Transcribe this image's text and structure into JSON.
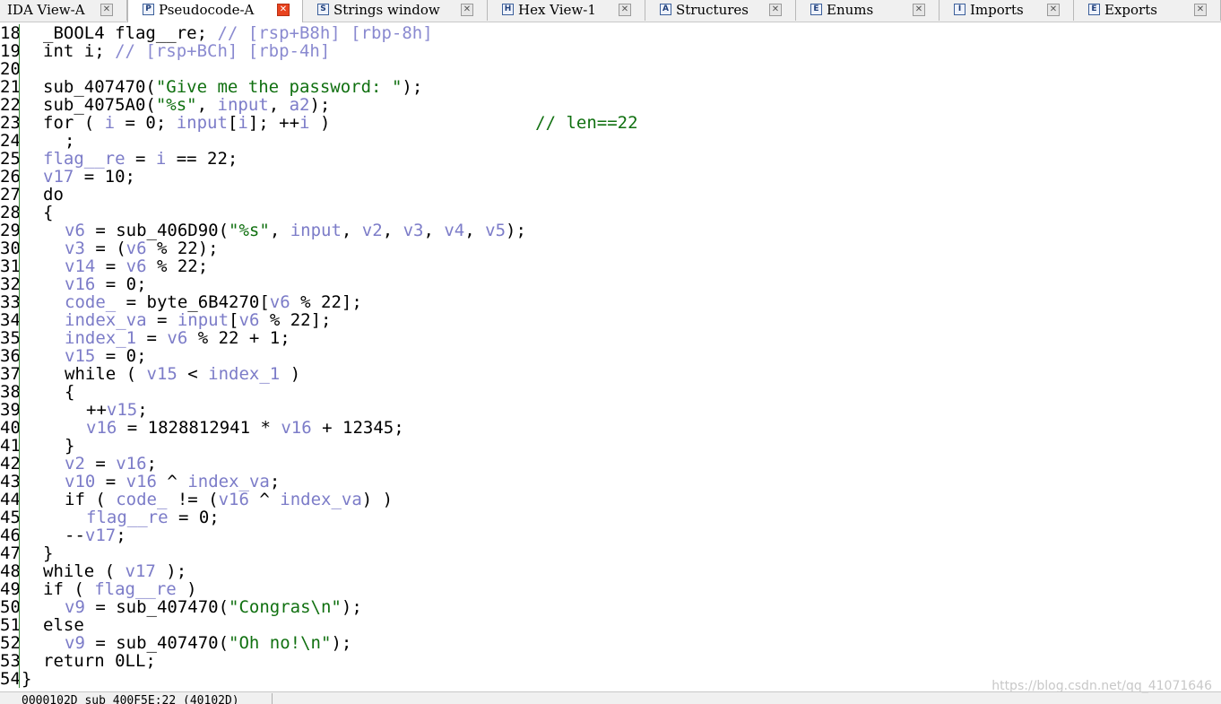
{
  "tabs": [
    {
      "label": "IDA View-A",
      "icon": "ida-view-icon",
      "active": false
    },
    {
      "label": "Pseudocode-A",
      "icon": "pseudocode-icon",
      "active": true
    },
    {
      "label": "Strings window",
      "icon": "strings-icon",
      "active": false
    },
    {
      "label": "Hex View-1",
      "icon": "hex-view-icon",
      "active": false
    },
    {
      "label": "Structures",
      "icon": "structures-icon",
      "active": false
    },
    {
      "label": "Enums",
      "icon": "enums-icon",
      "active": false
    },
    {
      "label": "Imports",
      "icon": "imports-icon",
      "active": false
    },
    {
      "label": "Exports",
      "icon": "exports-icon",
      "active": false
    }
  ],
  "code_lines": [
    {
      "num": "18",
      "indent": 1,
      "segments": [
        {
          "t": "_BOOL4 flag__re; ",
          "c": "k"
        },
        {
          "t": "// [rsp+B8h] [rbp-8h]",
          "c": "trans"
        }
      ]
    },
    {
      "num": "19",
      "indent": 1,
      "segments": [
        {
          "t": "int i; ",
          "c": "k"
        },
        {
          "t": "// [rsp+BCh] [rbp-4h]",
          "c": "trans"
        }
      ]
    },
    {
      "num": "20",
      "indent": 0,
      "segments": []
    },
    {
      "num": "21",
      "indent": 1,
      "segments": [
        {
          "t": "sub_407470(",
          "c": "k"
        },
        {
          "t": "\"Give me the password: \"",
          "c": "str"
        },
        {
          "t": ");",
          "c": "k"
        }
      ]
    },
    {
      "num": "22",
      "indent": 1,
      "segments": [
        {
          "t": "sub_4075A0(",
          "c": "k"
        },
        {
          "t": "\"%s\"",
          "c": "str"
        },
        {
          "t": ", ",
          "c": "k"
        },
        {
          "t": "input",
          "c": "var"
        },
        {
          "t": ", ",
          "c": "k"
        },
        {
          "t": "a2",
          "c": "var"
        },
        {
          "t": ");",
          "c": "k"
        }
      ]
    },
    {
      "num": "23",
      "indent": 1,
      "segments": [
        {
          "t": "for ( ",
          "c": "k"
        },
        {
          "t": "i",
          "c": "var"
        },
        {
          "t": " = 0; ",
          "c": "k"
        },
        {
          "t": "input",
          "c": "var"
        },
        {
          "t": "[",
          "c": "k"
        },
        {
          "t": "i",
          "c": "var"
        },
        {
          "t": "]; ++",
          "c": "k"
        },
        {
          "t": "i",
          "c": "var"
        },
        {
          "t": " )                    ",
          "c": "k"
        },
        {
          "t": "// len==22",
          "c": "cmt"
        }
      ]
    },
    {
      "num": "24",
      "indent": 2,
      "segments": [
        {
          "t": ";",
          "c": "k"
        }
      ]
    },
    {
      "num": "25",
      "indent": 1,
      "segments": [
        {
          "t": "flag__re",
          "c": "var"
        },
        {
          "t": " = ",
          "c": "k"
        },
        {
          "t": "i",
          "c": "var"
        },
        {
          "t": " == 22;",
          "c": "k"
        }
      ]
    },
    {
      "num": "26",
      "indent": 1,
      "segments": [
        {
          "t": "v17",
          "c": "var"
        },
        {
          "t": " = 10;",
          "c": "k"
        }
      ]
    },
    {
      "num": "27",
      "indent": 1,
      "segments": [
        {
          "t": "do",
          "c": "k"
        }
      ]
    },
    {
      "num": "28",
      "indent": 1,
      "segments": [
        {
          "t": "{",
          "c": "k"
        }
      ]
    },
    {
      "num": "29",
      "indent": 2,
      "segments": [
        {
          "t": "v6",
          "c": "var"
        },
        {
          "t": " = sub_406D90(",
          "c": "k"
        },
        {
          "t": "\"%s\"",
          "c": "str"
        },
        {
          "t": ", ",
          "c": "k"
        },
        {
          "t": "input",
          "c": "var"
        },
        {
          "t": ", ",
          "c": "k"
        },
        {
          "t": "v2",
          "c": "var"
        },
        {
          "t": ", ",
          "c": "k"
        },
        {
          "t": "v3",
          "c": "var"
        },
        {
          "t": ", ",
          "c": "k"
        },
        {
          "t": "v4",
          "c": "var"
        },
        {
          "t": ", ",
          "c": "k"
        },
        {
          "t": "v5",
          "c": "var"
        },
        {
          "t": ");",
          "c": "k"
        }
      ]
    },
    {
      "num": "30",
      "indent": 2,
      "segments": [
        {
          "t": "v3",
          "c": "var"
        },
        {
          "t": " = (",
          "c": "k"
        },
        {
          "t": "v6",
          "c": "var"
        },
        {
          "t": " % 22);",
          "c": "k"
        }
      ]
    },
    {
      "num": "31",
      "indent": 2,
      "segments": [
        {
          "t": "v14",
          "c": "var"
        },
        {
          "t": " = ",
          "c": "k"
        },
        {
          "t": "v6",
          "c": "var"
        },
        {
          "t": " % 22;",
          "c": "k"
        }
      ]
    },
    {
      "num": "32",
      "indent": 2,
      "segments": [
        {
          "t": "v16",
          "c": "var"
        },
        {
          "t": " = 0;",
          "c": "k"
        }
      ]
    },
    {
      "num": "33",
      "indent": 2,
      "segments": [
        {
          "t": "code_",
          "c": "var"
        },
        {
          "t": " = byte_6B4270[",
          "c": "k"
        },
        {
          "t": "v6",
          "c": "var"
        },
        {
          "t": " % 22];",
          "c": "k"
        }
      ]
    },
    {
      "num": "34",
      "indent": 2,
      "segments": [
        {
          "t": "index_va",
          "c": "var"
        },
        {
          "t": " = ",
          "c": "k"
        },
        {
          "t": "input",
          "c": "var"
        },
        {
          "t": "[",
          "c": "k"
        },
        {
          "t": "v6",
          "c": "var"
        },
        {
          "t": " % 22];",
          "c": "k"
        }
      ]
    },
    {
      "num": "35",
      "indent": 2,
      "segments": [
        {
          "t": "index_1",
          "c": "var"
        },
        {
          "t": " = ",
          "c": "k"
        },
        {
          "t": "v6",
          "c": "var"
        },
        {
          "t": " % 22 + 1;",
          "c": "k"
        }
      ]
    },
    {
      "num": "36",
      "indent": 2,
      "segments": [
        {
          "t": "v15",
          "c": "var"
        },
        {
          "t": " = 0;",
          "c": "k"
        }
      ]
    },
    {
      "num": "37",
      "indent": 2,
      "segments": [
        {
          "t": "while ( ",
          "c": "k"
        },
        {
          "t": "v15",
          "c": "var"
        },
        {
          "t": " < ",
          "c": "k"
        },
        {
          "t": "index_1",
          "c": "var"
        },
        {
          "t": " )",
          "c": "k"
        }
      ]
    },
    {
      "num": "38",
      "indent": 2,
      "segments": [
        {
          "t": "{",
          "c": "k"
        }
      ]
    },
    {
      "num": "39",
      "indent": 3,
      "segments": [
        {
          "t": "++",
          "c": "k"
        },
        {
          "t": "v15",
          "c": "var"
        },
        {
          "t": ";",
          "c": "k"
        }
      ]
    },
    {
      "num": "40",
      "indent": 3,
      "segments": [
        {
          "t": "v16",
          "c": "var"
        },
        {
          "t": " = 1828812941 * ",
          "c": "k"
        },
        {
          "t": "v16",
          "c": "var"
        },
        {
          "t": " + 12345;",
          "c": "k"
        }
      ]
    },
    {
      "num": "41",
      "indent": 2,
      "segments": [
        {
          "t": "}",
          "c": "k"
        }
      ]
    },
    {
      "num": "42",
      "indent": 2,
      "segments": [
        {
          "t": "v2",
          "c": "var"
        },
        {
          "t": " = ",
          "c": "k"
        },
        {
          "t": "v16",
          "c": "var"
        },
        {
          "t": ";",
          "c": "k"
        }
      ]
    },
    {
      "num": "43",
      "indent": 2,
      "segments": [
        {
          "t": "v10",
          "c": "var"
        },
        {
          "t": " = ",
          "c": "k"
        },
        {
          "t": "v16",
          "c": "var"
        },
        {
          "t": " ^ ",
          "c": "k"
        },
        {
          "t": "index_va",
          "c": "var"
        },
        {
          "t": ";",
          "c": "k"
        }
      ]
    },
    {
      "num": "44",
      "indent": 2,
      "segments": [
        {
          "t": "if ( ",
          "c": "k"
        },
        {
          "t": "code_",
          "c": "var"
        },
        {
          "t": " != (",
          "c": "k"
        },
        {
          "t": "v16",
          "c": "var"
        },
        {
          "t": " ^ ",
          "c": "k"
        },
        {
          "t": "index_va",
          "c": "var"
        },
        {
          "t": ") )",
          "c": "k"
        }
      ]
    },
    {
      "num": "45",
      "indent": 3,
      "segments": [
        {
          "t": "flag__re",
          "c": "var"
        },
        {
          "t": " = 0;",
          "c": "k"
        }
      ]
    },
    {
      "num": "46",
      "indent": 2,
      "segments": [
        {
          "t": "--",
          "c": "k"
        },
        {
          "t": "v17",
          "c": "var"
        },
        {
          "t": ";",
          "c": "k"
        }
      ]
    },
    {
      "num": "47",
      "indent": 1,
      "segments": [
        {
          "t": "}",
          "c": "k"
        }
      ]
    },
    {
      "num": "48",
      "indent": 1,
      "segments": [
        {
          "t": "while ( ",
          "c": "k"
        },
        {
          "t": "v17",
          "c": "var"
        },
        {
          "t": " );",
          "c": "k"
        }
      ]
    },
    {
      "num": "49",
      "indent": 1,
      "segments": [
        {
          "t": "if ( ",
          "c": "k"
        },
        {
          "t": "flag__re",
          "c": "var"
        },
        {
          "t": " )",
          "c": "k"
        }
      ]
    },
    {
      "num": "50",
      "indent": 2,
      "segments": [
        {
          "t": "v9",
          "c": "var"
        },
        {
          "t": " = sub_407470(",
          "c": "k"
        },
        {
          "t": "\"Congras\\n\"",
          "c": "str"
        },
        {
          "t": ");",
          "c": "k"
        }
      ]
    },
    {
      "num": "51",
      "indent": 1,
      "segments": [
        {
          "t": "else",
          "c": "k"
        }
      ]
    },
    {
      "num": "52",
      "indent": 2,
      "segments": [
        {
          "t": "v9",
          "c": "var"
        },
        {
          "t": " = sub_407470(",
          "c": "k"
        },
        {
          "t": "\"Oh no!\\n\"",
          "c": "str"
        },
        {
          "t": ");",
          "c": "k"
        }
      ]
    },
    {
      "num": "53",
      "indent": 1,
      "segments": [
        {
          "t": "return 0LL;",
          "c": "k"
        }
      ]
    },
    {
      "num": "54",
      "indent": 0,
      "segments": [
        {
          "t": "}",
          "c": "k"
        }
      ]
    }
  ],
  "status": {
    "address_text": "0000102D  sub_400F5E:22 (40102D)"
  },
  "watermark": "https://blog.csdn.net/qq_41071646",
  "colors": {
    "variable": "#7c7cc8",
    "string": "#107010",
    "comment": "#107010",
    "keyword": "#000000",
    "active_close": "#e8431f"
  }
}
